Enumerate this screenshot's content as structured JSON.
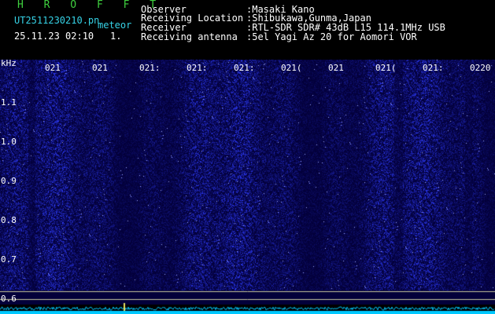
{
  "header": {
    "title": "H R O F F T",
    "filename": "UT2511230210.pn",
    "mode": "meteor",
    "datetime": "25.11.23 02:10",
    "index": "1.",
    "info_labels": [
      "Observer",
      "Receiving Location",
      "Receiver",
      "Receiving antenna"
    ],
    "info_values": [
      ":Masaki Kano",
      ":Shibukawa,Gunma,Japan",
      ":RTL-SDR SDR# 43dB L15 114.1MHz USB",
      ":5el Yagi Az 20 for Aomori VOR"
    ]
  },
  "spectrogram": {
    "y_unit": "kHz",
    "y_ticks": [
      "1.1",
      "1.0",
      "0.9",
      "0.8",
      "0.7",
      "0.6"
    ],
    "x_ticks": [
      "021",
      "021",
      "021:",
      "021:",
      "021:",
      "021(",
      "021",
      "021(",
      "021:",
      "0220"
    ],
    "colors": {
      "background": "#03003a",
      "noise": "#2a3ad8",
      "trace": "#00c8ff",
      "marker": "#e8e060"
    }
  }
}
